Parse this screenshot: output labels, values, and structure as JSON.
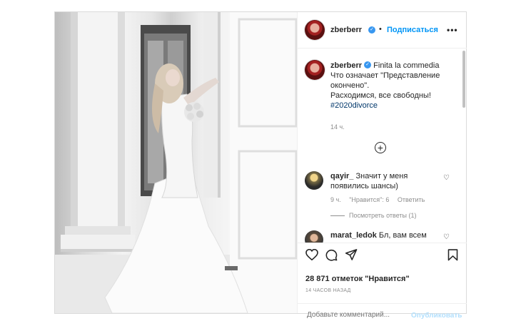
{
  "post": {
    "username": "zberberr",
    "follow_label": "Подписаться",
    "dot": "•",
    "more_label": "•••",
    "caption": {
      "username": "zberberr",
      "text_1": "Finita la commedia",
      "text_2": "Что означает \"Представление окончено\".",
      "text_3": "Расходимся, все свободны!",
      "hashtag": "#2020divorce",
      "time": "14 ч."
    },
    "load_more": "+",
    "comments": [
      {
        "username": "qayir_",
        "text": "Значит у меня появились шансы)",
        "time": "9 ч.",
        "likes": "\"Нравится\": 6",
        "reply": "Ответить",
        "view_replies": "Посмотреть ответы (1)"
      },
      {
        "username": "marat_ledok",
        "text": "Бл, вам всем не похрен на личную жизнь Зои?"
      }
    ],
    "likes": "28 871 отметок \"Нравится\"",
    "posted_ago": "14 ЧАСОВ НАЗАД",
    "comment_placeholder": "Добавьте комментарий...",
    "publish_label": "Опубликовать"
  },
  "icons": [
    "heart-icon",
    "comment-icon",
    "share-icon",
    "bookmark-icon",
    "verified-icon",
    "add-circle-icon"
  ]
}
